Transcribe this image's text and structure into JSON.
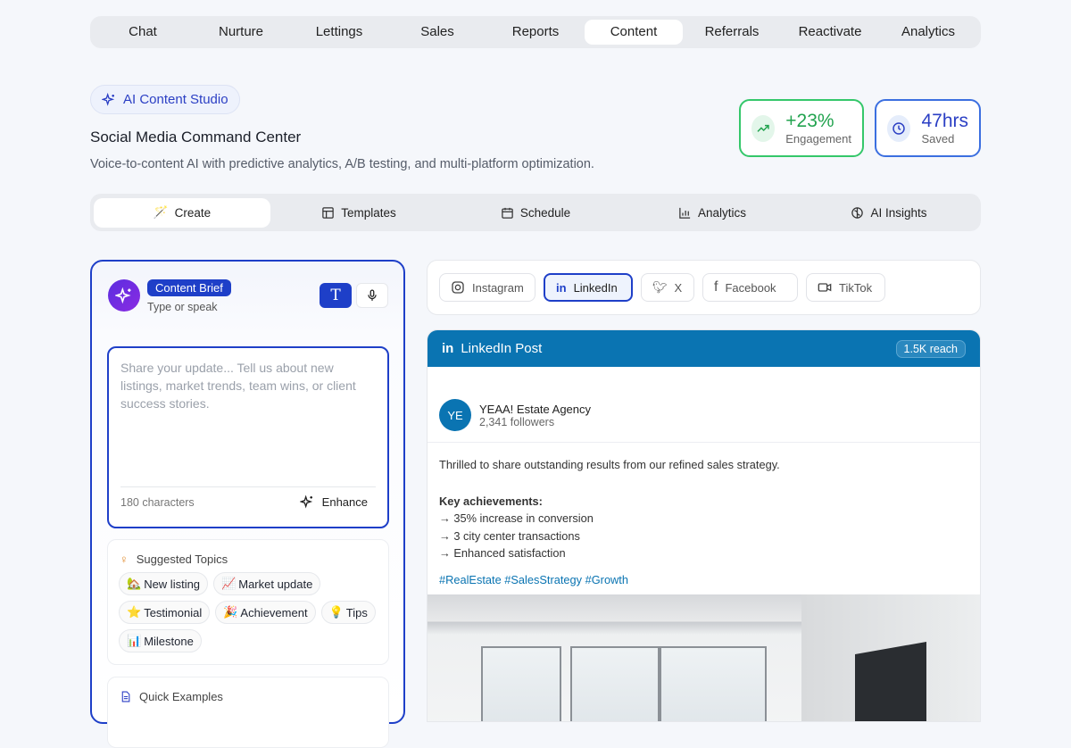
{
  "nav": [
    "Chat",
    "Nurture",
    "Lettings",
    "Sales",
    "Reports",
    "Content",
    "Referrals",
    "Reactivate",
    "Analytics"
  ],
  "nav_active": "Content",
  "header": {
    "badge": "AI Content Studio",
    "title": "Social Media Command Center",
    "subtitle": "Voice-to-content AI with predictive analytics, A/B testing, and multi-platform optimization."
  },
  "stats": [
    {
      "value": "+23%",
      "label": "Engagement",
      "icon": "trending-up-icon",
      "color": "#22c55e"
    },
    {
      "value": "47hrs",
      "label": "Saved",
      "icon": "clock-icon",
      "color": "#3b6fe0"
    }
  ],
  "tabs": [
    {
      "label": "Create",
      "icon": "wand-icon"
    },
    {
      "label": "Templates",
      "icon": "layout-icon"
    },
    {
      "label": "Schedule",
      "icon": "calendar-icon"
    },
    {
      "label": "Analytics",
      "icon": "bar-chart-icon"
    },
    {
      "label": "AI Insights",
      "icon": "brain-icon"
    }
  ],
  "brief": {
    "label": "Content Brief",
    "sub": "Type or speak",
    "text_mode": "T",
    "placeholder": "Share your update... Tell us about new listings, market trends, team wins, or client success stories.",
    "chars": "180 characters",
    "enhance": "Enhance"
  },
  "topics": {
    "title": "Suggested Topics",
    "items": [
      {
        "emoji": "🏡",
        "label": "New listing"
      },
      {
        "emoji": "📈",
        "label": "Market update"
      },
      {
        "emoji": "⭐",
        "label": "Testimonial"
      },
      {
        "emoji": "🎉",
        "label": "Achievement"
      },
      {
        "emoji": "💡",
        "label": "Tips"
      },
      {
        "emoji": "📊",
        "label": "Milestone"
      }
    ]
  },
  "examples": {
    "title": "Quick Examples"
  },
  "platforms": [
    "Instagram",
    "LinkedIn",
    "X",
    "Facebook",
    "TikTok"
  ],
  "platform_active": "LinkedIn",
  "post": {
    "header": "LinkedIn Post",
    "reach": "1.5K reach",
    "avatar": "YE",
    "author": "YEAA! Estate Agency",
    "followers": "2,341 followers",
    "intro": "Thrilled to share outstanding results from our refined sales strategy.",
    "key": "Key achievements:",
    "bullets": [
      "→ 35% increase in conversion",
      "→ 3 city center transactions",
      "→ Enhanced satisfaction"
    ],
    "tags": "#RealEstate #SalesStrategy #Growth"
  }
}
